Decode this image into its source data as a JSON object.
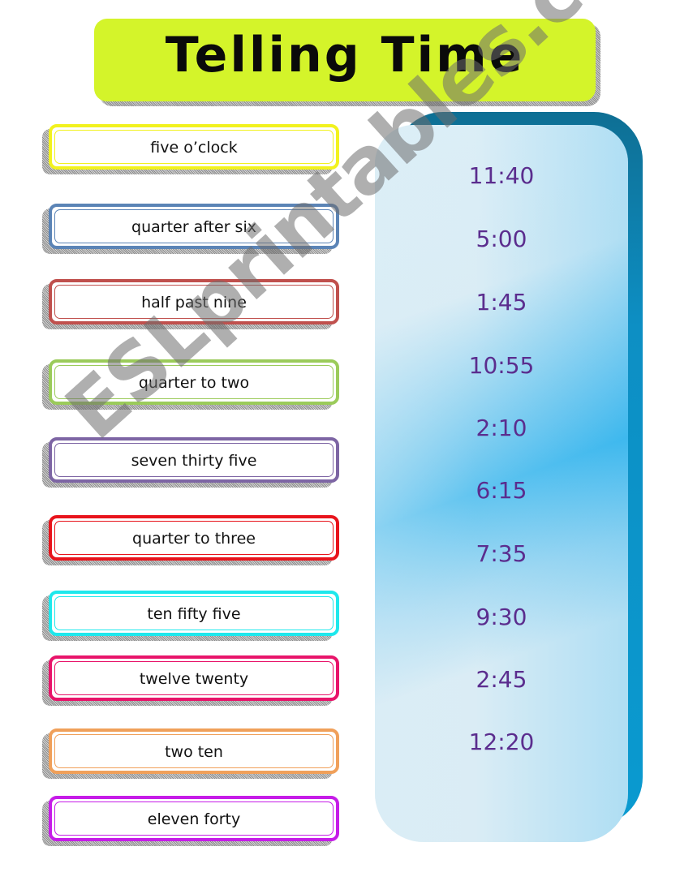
{
  "title": "Telling Time",
  "phrases": [
    {
      "label": "five o’clock",
      "color": "#f2f21e"
    },
    {
      "label": "quarter after six",
      "color": "#5b84b6"
    },
    {
      "label": "half past nine",
      "color": "#c0504d"
    },
    {
      "label": "quarter to two",
      "color": "#9bcb5a"
    },
    {
      "label": "seven thirty five",
      "color": "#7d65a4"
    },
    {
      "label": "quarter to three",
      "color": "#e8141c"
    },
    {
      "label": "ten fifty five",
      "color": "#1ee8ec"
    },
    {
      "label": "twelve twenty",
      "color": "#e8146a"
    },
    {
      "label": "two ten",
      "color": "#f0a05a"
    },
    {
      "label": "eleven forty",
      "color": "#c61ce8"
    }
  ],
  "times": [
    "11:40",
    "5:00",
    "1:45",
    "10:55",
    "2:10",
    "6:15",
    "7:35",
    "9:30",
    "2:45",
    "12:20"
  ],
  "watermark": "ESLprintables.com",
  "colors": {
    "title_bg": "#d4f42a",
    "time_text": "#5b2d8e",
    "panel_blue": "#0a9ad0"
  }
}
